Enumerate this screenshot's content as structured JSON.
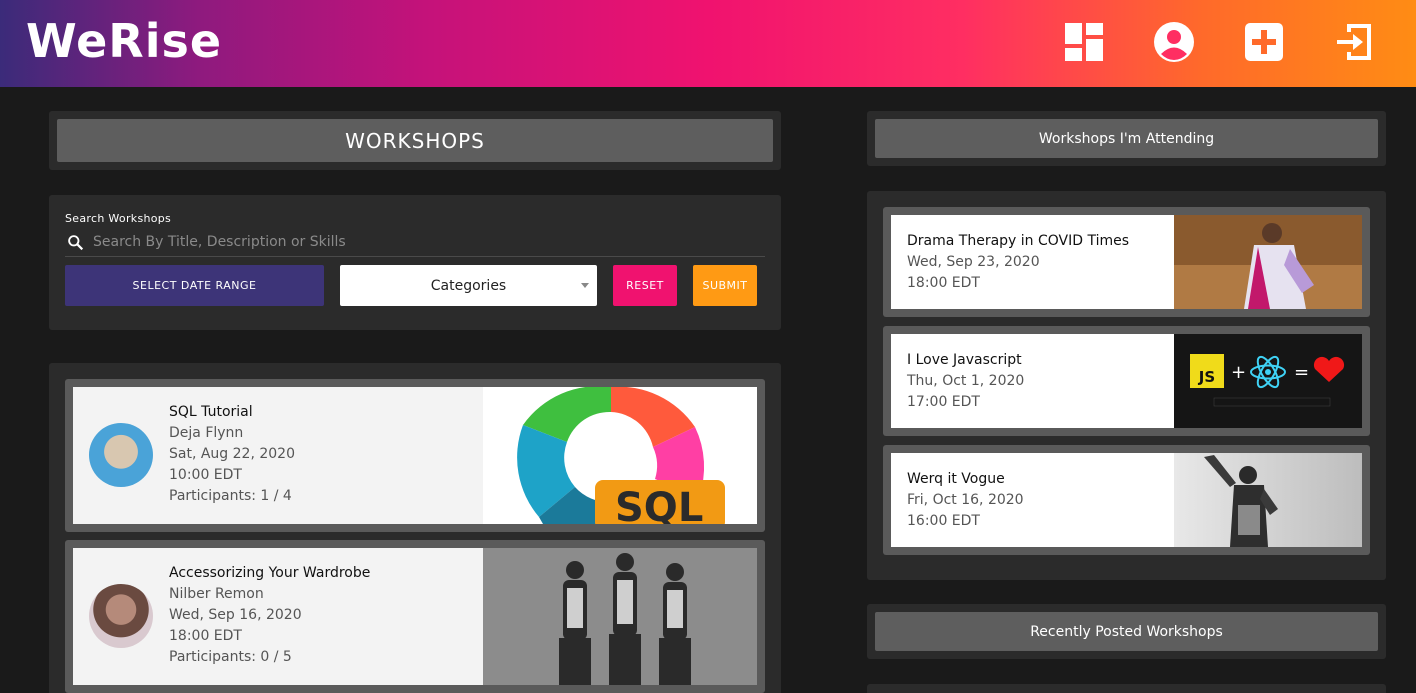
{
  "app": {
    "logo": "WeRise"
  },
  "header": {
    "icons": [
      {
        "name": "dashboard-icon"
      },
      {
        "name": "account-icon"
      },
      {
        "name": "add-icon"
      },
      {
        "name": "logout-icon"
      }
    ]
  },
  "workshops_panel": {
    "title": "WORKSHOPS"
  },
  "search": {
    "label": "Search Workshops",
    "placeholder": "Search By Title, Description or Skills",
    "value": ""
  },
  "filters": {
    "date_range_label": "SELECT DATE RANGE",
    "category_selected": "Categories",
    "reset_label": "RESET",
    "submit_label": "SUBMIT"
  },
  "workshops": [
    {
      "title": "SQL Tutorial",
      "host": "Deja Flynn",
      "date": "Sat, Aug 22, 2020",
      "time": "10:00 EDT",
      "participants": "Participants: 1 / 4",
      "thumb_text": "SQL"
    },
    {
      "title": "Accessorizing Your Wardrobe",
      "host": "Nilber Remon",
      "date": "Wed, Sep 16, 2020",
      "time": "18:00 EDT",
      "participants": "Participants: 0 / 5"
    }
  ],
  "attending": {
    "title": "Workshops I'm Attending",
    "items": [
      {
        "title": "Drama Therapy in COVID Times",
        "date": "Wed, Sep 23, 2020",
        "time": "18:00 EDT"
      },
      {
        "title": "I Love Javascript",
        "date": "Thu, Oct 1, 2020",
        "time": "17:00 EDT",
        "thumb_badge": "JS"
      },
      {
        "title": "Werq it Vogue",
        "date": "Fri, Oct 16, 2020",
        "time": "16:00 EDT"
      }
    ]
  },
  "recent": {
    "title": "Recently Posted Workshops"
  },
  "colors": {
    "date_button": "#3d3478",
    "reset_button": "#f0126f",
    "submit_button": "#ff9a14",
    "panel": "#2b2b2b",
    "title_bar": "#5e5e5e"
  }
}
